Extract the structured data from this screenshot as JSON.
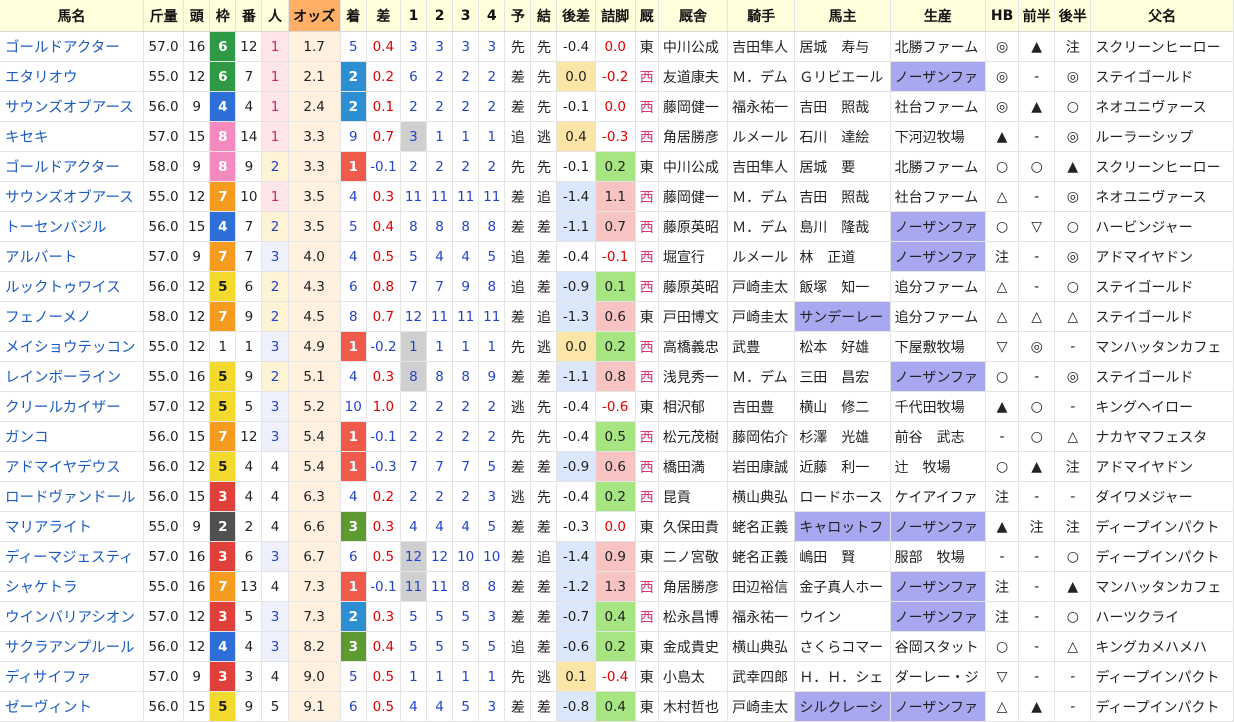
{
  "headers": [
    "馬名",
    "斤量",
    "頭",
    "枠",
    "番",
    "人",
    "オッズ",
    "着",
    "差",
    "1",
    "2",
    "3",
    "4",
    "予",
    "結",
    "後差",
    "詰脚",
    "厩",
    "厩舎",
    "騎手",
    "馬主",
    "生産",
    "HB",
    "前半",
    "後半",
    "父名"
  ],
  "rows": [
    {
      "name": "ゴールドアクター",
      "kin": "57.0",
      "tou": "16",
      "waku": "6",
      "ban": "12",
      "pop": "1",
      "odds": "1.7",
      "fin": "5",
      "sa": "0.4",
      "p1": "3",
      "p2": "3",
      "p3": "3",
      "p4": "3",
      "yo": "先",
      "ke": "先",
      "kousa": "-0.4",
      "tsume": "0.0",
      "umaya": "東",
      "stable": "中川公成",
      "jockey": "吉田隼人",
      "owner": "居城　寿与",
      "farm": "北勝ファーム",
      "hb": "◎",
      "zen": "▲",
      "kou": "注",
      "sire": "スクリーンヒーロー"
    },
    {
      "name": "エタリオウ",
      "kin": "55.0",
      "tou": "12",
      "waku": "6",
      "ban": "7",
      "pop": "1",
      "odds": "2.1",
      "fin": "2",
      "sa": "0.2",
      "p1": "6",
      "p2": "2",
      "p3": "2",
      "p4": "2",
      "yo": "差",
      "ke": "先",
      "kousa": "0.0",
      "tsume": "-0.2",
      "umaya": "西",
      "stable": "友道康夫",
      "jockey": "Ｍ．デム",
      "owner": "Ｇリビエール",
      "farm": "ノーザンファ",
      "hb": "◎",
      "zen": "-",
      "kou": "◎",
      "sire": "ステイゴールド"
    },
    {
      "name": "サウンズオブアース",
      "kin": "56.0",
      "tou": "9",
      "waku": "4",
      "ban": "4",
      "pop": "1",
      "odds": "2.4",
      "fin": "2",
      "sa": "0.1",
      "p1": "2",
      "p2": "2",
      "p3": "2",
      "p4": "2",
      "yo": "差",
      "ke": "先",
      "kousa": "-0.1",
      "tsume": "0.0",
      "umaya": "西",
      "stable": "藤岡健一",
      "jockey": "福永祐一",
      "owner": "吉田　照哉",
      "farm": "社台ファーム",
      "hb": "◎",
      "zen": "▲",
      "kou": "○",
      "sire": "ネオユニヴァース"
    },
    {
      "name": "キセキ",
      "kin": "57.0",
      "tou": "15",
      "waku": "8",
      "ban": "14",
      "pop": "1",
      "odds": "3.3",
      "fin": "9",
      "sa": "0.7",
      "p1": "3",
      "p2": "1",
      "p3": "1",
      "p4": "1",
      "yo": "追",
      "ke": "逃",
      "kousa": "0.4",
      "tsume": "-0.3",
      "umaya": "西",
      "stable": "角居勝彦",
      "jockey": "ルメール",
      "owner": "石川　達絵",
      "farm": "下河辺牧場",
      "hb": "▲",
      "zen": "-",
      "kou": "◎",
      "sire": "ルーラーシップ"
    },
    {
      "name": "ゴールドアクター",
      "kin": "58.0",
      "tou": "9",
      "waku": "8",
      "ban": "9",
      "pop": "2",
      "odds": "3.3",
      "fin": "1",
      "sa": "-0.1",
      "p1": "2",
      "p2": "2",
      "p3": "2",
      "p4": "2",
      "yo": "先",
      "ke": "先",
      "kousa": "-0.1",
      "tsume": "0.2",
      "umaya": "東",
      "stable": "中川公成",
      "jockey": "吉田隼人",
      "owner": "居城　要",
      "farm": "北勝ファーム",
      "hb": "○",
      "zen": "○",
      "kou": "▲",
      "sire": "スクリーンヒーロー"
    },
    {
      "name": "サウンズオブアース",
      "kin": "55.0",
      "tou": "12",
      "waku": "7",
      "ban": "10",
      "pop": "1",
      "odds": "3.5",
      "fin": "4",
      "sa": "0.3",
      "p1": "11",
      "p2": "11",
      "p3": "11",
      "p4": "11",
      "yo": "差",
      "ke": "追",
      "kousa": "-1.4",
      "tsume": "1.1",
      "umaya": "西",
      "stable": "藤岡健一",
      "jockey": "Ｍ．デム",
      "owner": "吉田　照哉",
      "farm": "社台ファーム",
      "hb": "△",
      "zen": "-",
      "kou": "◎",
      "sire": "ネオユニヴァース"
    },
    {
      "name": "トーセンバジル",
      "kin": "56.0",
      "tou": "15",
      "waku": "4",
      "ban": "7",
      "pop": "2",
      "odds": "3.5",
      "fin": "5",
      "sa": "0.4",
      "p1": "8",
      "p2": "8",
      "p3": "8",
      "p4": "8",
      "yo": "差",
      "ke": "差",
      "kousa": "-1.1",
      "tsume": "0.7",
      "umaya": "西",
      "stable": "藤原英昭",
      "jockey": "Ｍ．デム",
      "owner": "島川　隆哉",
      "farm": "ノーザンファ",
      "hb": "○",
      "zen": "▽",
      "kou": "○",
      "sire": "ハービンジャー"
    },
    {
      "name": "アルバート",
      "kin": "57.0",
      "tou": "9",
      "waku": "7",
      "ban": "7",
      "pop": "3",
      "odds": "4.0",
      "fin": "4",
      "sa": "0.5",
      "p1": "5",
      "p2": "4",
      "p3": "4",
      "p4": "5",
      "yo": "追",
      "ke": "差",
      "kousa": "-0.4",
      "tsume": "-0.1",
      "umaya": "西",
      "stable": "堀宣行",
      "jockey": "ルメール",
      "owner": "林　正道",
      "farm": "ノーザンファ",
      "hb": "注",
      "zen": "-",
      "kou": "◎",
      "sire": "アドマイヤドン"
    },
    {
      "name": "ルックトゥワイス",
      "kin": "56.0",
      "tou": "12",
      "waku": "5",
      "ban": "6",
      "pop": "2",
      "odds": "4.3",
      "fin": "6",
      "sa": "0.8",
      "p1": "7",
      "p2": "7",
      "p3": "9",
      "p4": "8",
      "yo": "追",
      "ke": "差",
      "kousa": "-0.9",
      "tsume": "0.1",
      "umaya": "西",
      "stable": "藤原英昭",
      "jockey": "戸崎圭太",
      "owner": "飯塚　知一",
      "farm": "追分ファーム",
      "hb": "△",
      "zen": "-",
      "kou": "○",
      "sire": "ステイゴールド"
    },
    {
      "name": "フェノーメノ",
      "kin": "58.0",
      "tou": "12",
      "waku": "7",
      "ban": "9",
      "pop": "2",
      "odds": "4.5",
      "fin": "8",
      "sa": "0.7",
      "p1": "12",
      "p2": "11",
      "p3": "11",
      "p4": "11",
      "yo": "差",
      "ke": "追",
      "kousa": "-1.3",
      "tsume": "0.6",
      "umaya": "東",
      "stable": "戸田博文",
      "jockey": "戸崎圭太",
      "owner": "サンデーレー",
      "farm": "追分ファーム",
      "hb": "△",
      "zen": "△",
      "kou": "△",
      "sire": "ステイゴールド"
    },
    {
      "name": "メイショウテッコン",
      "kin": "55.0",
      "tou": "12",
      "waku": "1",
      "ban": "1",
      "pop": "3",
      "odds": "4.9",
      "fin": "1",
      "sa": "-0.2",
      "p1": "1",
      "p2": "1",
      "p3": "1",
      "p4": "1",
      "yo": "先",
      "ke": "逃",
      "kousa": "0.0",
      "tsume": "0.2",
      "umaya": "西",
      "stable": "高橋義忠",
      "jockey": "武豊",
      "owner": "松本　好雄",
      "farm": "下屋敷牧場",
      "hb": "▽",
      "zen": "◎",
      "kou": "-",
      "sire": "マンハッタンカフェ"
    },
    {
      "name": "レインボーライン",
      "kin": "55.0",
      "tou": "16",
      "waku": "5",
      "ban": "9",
      "pop": "2",
      "odds": "5.1",
      "fin": "4",
      "sa": "0.3",
      "p1": "8",
      "p2": "8",
      "p3": "8",
      "p4": "9",
      "yo": "差",
      "ke": "差",
      "kousa": "-1.1",
      "tsume": "0.8",
      "umaya": "西",
      "stable": "浅見秀一",
      "jockey": "Ｍ．デム",
      "owner": "三田　昌宏",
      "farm": "ノーザンファ",
      "hb": "○",
      "zen": "-",
      "kou": "◎",
      "sire": "ステイゴールド"
    },
    {
      "name": "クリールカイザー",
      "kin": "57.0",
      "tou": "12",
      "waku": "5",
      "ban": "5",
      "pop": "3",
      "odds": "5.2",
      "fin": "10",
      "sa": "1.0",
      "p1": "2",
      "p2": "2",
      "p3": "2",
      "p4": "2",
      "yo": "逃",
      "ke": "先",
      "kousa": "-0.4",
      "tsume": "-0.6",
      "umaya": "東",
      "stable": "相沢郁",
      "jockey": "吉田豊",
      "owner": "横山　修二",
      "farm": "千代田牧場",
      "hb": "▲",
      "zen": "○",
      "kou": "-",
      "sire": "キングヘイロー"
    },
    {
      "name": "ガンコ",
      "kin": "56.0",
      "tou": "15",
      "waku": "7",
      "ban": "12",
      "pop": "3",
      "odds": "5.4",
      "fin": "1",
      "sa": "-0.1",
      "p1": "2",
      "p2": "2",
      "p3": "2",
      "p4": "2",
      "yo": "先",
      "ke": "先",
      "kousa": "-0.4",
      "tsume": "0.5",
      "umaya": "西",
      "stable": "松元茂樹",
      "jockey": "藤岡佑介",
      "owner": "杉澤　光雄",
      "farm": "前谷　武志",
      "hb": "-",
      "zen": "○",
      "kou": "△",
      "sire": "ナカヤマフェスタ"
    },
    {
      "name": "アドマイヤデウス",
      "kin": "56.0",
      "tou": "12",
      "waku": "5",
      "ban": "4",
      "pop": "4",
      "odds": "5.4",
      "fin": "1",
      "sa": "-0.3",
      "p1": "7",
      "p2": "7",
      "p3": "7",
      "p4": "5",
      "yo": "差",
      "ke": "差",
      "kousa": "-0.9",
      "tsume": "0.6",
      "umaya": "西",
      "stable": "橋田満",
      "jockey": "岩田康誠",
      "owner": "近藤　利一",
      "farm": "辻　牧場",
      "hb": "○",
      "zen": "▲",
      "kou": "注",
      "sire": "アドマイヤドン"
    },
    {
      "name": "ロードヴァンドール",
      "kin": "56.0",
      "tou": "15",
      "waku": "3",
      "ban": "4",
      "pop": "4",
      "odds": "6.3",
      "fin": "4",
      "sa": "0.2",
      "p1": "2",
      "p2": "2",
      "p3": "2",
      "p4": "3",
      "yo": "逃",
      "ke": "先",
      "kousa": "-0.4",
      "tsume": "0.2",
      "umaya": "西",
      "stable": "昆貢",
      "jockey": "横山典弘",
      "owner": "ロードホース",
      "farm": "ケイアイファ",
      "hb": "注",
      "zen": "-",
      "kou": "-",
      "sire": "ダイワメジャー"
    },
    {
      "name": "マリアライト",
      "kin": "55.0",
      "tou": "9",
      "waku": "2",
      "ban": "2",
      "pop": "4",
      "odds": "6.6",
      "fin": "3",
      "sa": "0.3",
      "p1": "4",
      "p2": "4",
      "p3": "4",
      "p4": "5",
      "yo": "差",
      "ke": "差",
      "kousa": "-0.3",
      "tsume": "0.0",
      "umaya": "東",
      "stable": "久保田貴",
      "jockey": "蛯名正義",
      "owner": "キャロットフ",
      "farm": "ノーザンファ",
      "hb": "▲",
      "zen": "注",
      "kou": "注",
      "sire": "ディープインパクト"
    },
    {
      "name": "ディーマジェスティ",
      "kin": "57.0",
      "tou": "16",
      "waku": "3",
      "ban": "6",
      "pop": "3",
      "odds": "6.7",
      "fin": "6",
      "sa": "0.5",
      "p1": "12",
      "p2": "12",
      "p3": "10",
      "p4": "10",
      "yo": "差",
      "ke": "追",
      "kousa": "-1.4",
      "tsume": "0.9",
      "umaya": "東",
      "stable": "二ノ宮敬",
      "jockey": "蛯名正義",
      "owner": "嶋田　賢",
      "farm": "服部　牧場",
      "hb": "-",
      "zen": "-",
      "kou": "○",
      "sire": "ディープインパクト"
    },
    {
      "name": "シャケトラ",
      "kin": "55.0",
      "tou": "16",
      "waku": "7",
      "ban": "13",
      "pop": "4",
      "odds": "7.3",
      "fin": "1",
      "sa": "-0.1",
      "p1": "11",
      "p2": "11",
      "p3": "8",
      "p4": "8",
      "yo": "差",
      "ke": "差",
      "kousa": "-1.2",
      "tsume": "1.3",
      "umaya": "西",
      "stable": "角居勝彦",
      "jockey": "田辺裕信",
      "owner": "金子真人ホー",
      "farm": "ノーザンファ",
      "hb": "注",
      "zen": "-",
      "kou": "▲",
      "sire": "マンハッタンカフェ"
    },
    {
      "name": "ウインバリアシオン",
      "kin": "57.0",
      "tou": "12",
      "waku": "3",
      "ban": "5",
      "pop": "3",
      "odds": "7.3",
      "fin": "2",
      "sa": "0.3",
      "p1": "5",
      "p2": "5",
      "p3": "5",
      "p4": "3",
      "yo": "差",
      "ke": "差",
      "kousa": "-0.7",
      "tsume": "0.4",
      "umaya": "西",
      "stable": "松永昌博",
      "jockey": "福永祐一",
      "owner": "ウイン",
      "farm": "ノーザンファ",
      "hb": "注",
      "zen": "-",
      "kou": "○",
      "sire": "ハーツクライ"
    },
    {
      "name": "サクラアンプルール",
      "kin": "56.0",
      "tou": "12",
      "waku": "4",
      "ban": "4",
      "pop": "3",
      "odds": "8.2",
      "fin": "3",
      "sa": "0.4",
      "p1": "5",
      "p2": "5",
      "p3": "5",
      "p4": "5",
      "yo": "追",
      "ke": "差",
      "kousa": "-0.6",
      "tsume": "0.2",
      "umaya": "東",
      "stable": "金成貴史",
      "jockey": "横山典弘",
      "owner": "さくらコマー",
      "farm": "谷岡スタット",
      "hb": "○",
      "zen": "-",
      "kou": "△",
      "sire": "キングカメハメハ"
    },
    {
      "name": "ディサイファ",
      "kin": "57.0",
      "tou": "9",
      "waku": "3",
      "ban": "3",
      "pop": "4",
      "odds": "9.0",
      "fin": "5",
      "sa": "0.5",
      "p1": "1",
      "p2": "1",
      "p3": "1",
      "p4": "1",
      "yo": "先",
      "ke": "逃",
      "kousa": "0.1",
      "tsume": "-0.4",
      "umaya": "東",
      "stable": "小島太",
      "jockey": "武幸四郎",
      "owner": "Ｈ．Ｈ．シェ",
      "farm": "ダーレー・ジ",
      "hb": "▽",
      "zen": "-",
      "kou": "-",
      "sire": "ディープインパクト"
    },
    {
      "name": "ゼーヴィント",
      "kin": "56.0",
      "tou": "15",
      "waku": "5",
      "ban": "9",
      "pop": "5",
      "odds": "9.1",
      "fin": "6",
      "sa": "0.5",
      "p1": "4",
      "p2": "4",
      "p3": "5",
      "p4": "3",
      "yo": "差",
      "ke": "差",
      "kousa": "-0.8",
      "tsume": "0.4",
      "umaya": "東",
      "stable": "木村哲也",
      "jockey": "戸崎圭太",
      "owner": "シルクレーシ",
      "farm": "ノーザンファ",
      "hb": "△",
      "zen": "▲",
      "kou": "-",
      "sire": "ディープインパクト"
    }
  ]
}
